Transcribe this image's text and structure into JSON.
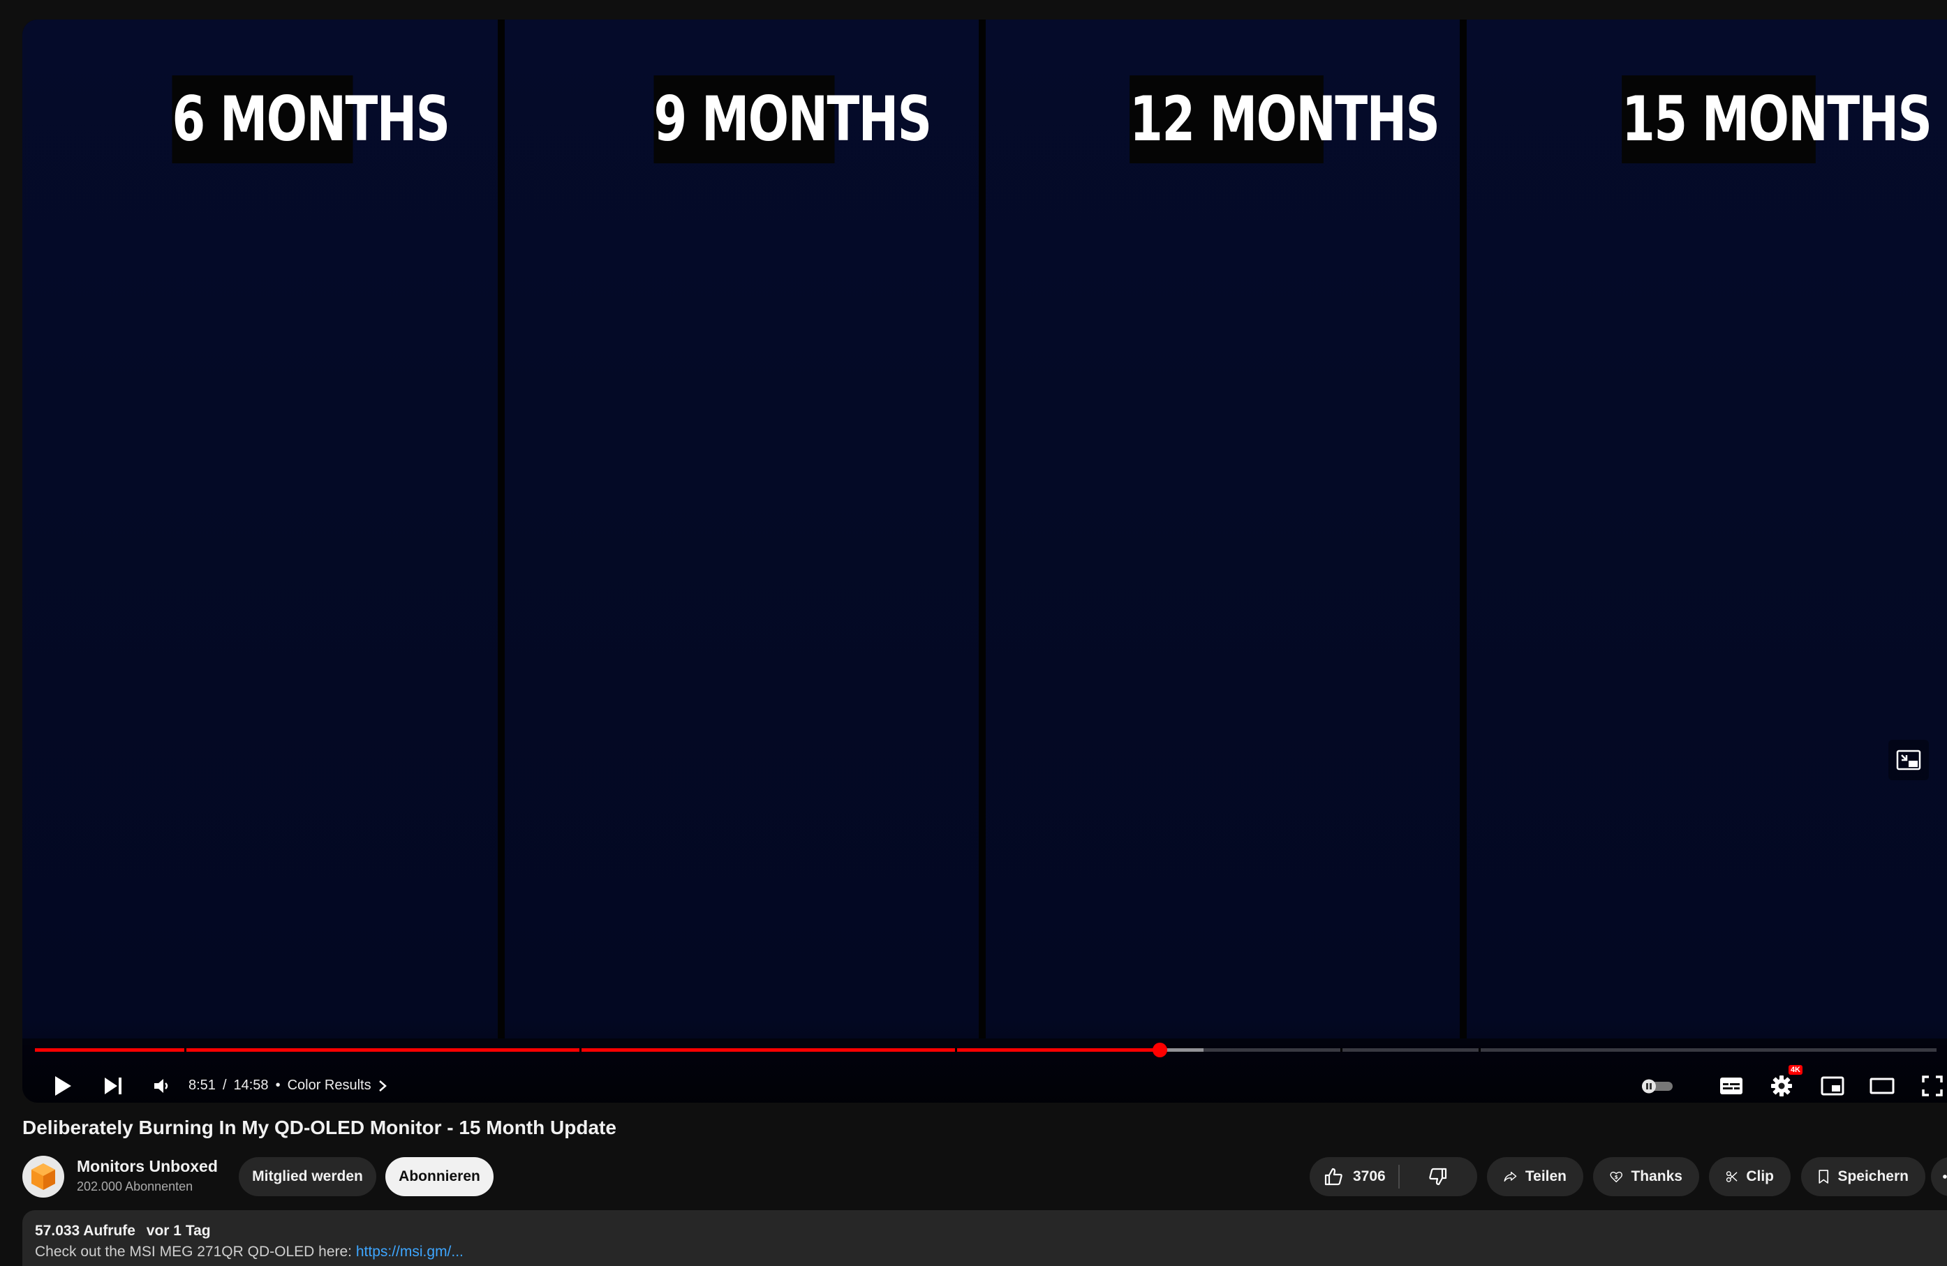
{
  "video": {
    "panels": [
      {
        "label": "6 MONTHS"
      },
      {
        "label": "9 MONTHS"
      },
      {
        "label": "12 MONTHS"
      },
      {
        "label": "15 MONTHS"
      }
    ]
  },
  "player": {
    "time_current": "8:51",
    "time_separator": "/",
    "time_total": "14:58",
    "chapter_separator": "•",
    "chapter_title": "Color Results",
    "progress_played_fraction": 0.5915,
    "progress_buffered_fraction": 0.6146,
    "quality_badge": "4K",
    "icons": {
      "play": "play-icon",
      "next": "next-icon",
      "volume": "volume-icon",
      "autoplay": "autoplay-toggle-icon",
      "subtitles": "subtitles-icon",
      "settings": "gear-icon",
      "miniplayer": "miniplayer-icon",
      "theater": "theater-mode-icon",
      "fullscreen": "fullscreen-icon"
    },
    "accent_color": "#ff0000"
  },
  "title": "Deliberately Burning In My QD-OLED Monitor - 15 Month Update",
  "channel": {
    "name": "Monitors Unboxed",
    "subscribers": "202.000 Abonnenten",
    "join_label": "Mitglied werden",
    "subscribe_label": "Abonnieren"
  },
  "actions": {
    "like_count": "3706",
    "share_label": "Teilen",
    "thanks_label": "Thanks",
    "clip_label": "Clip",
    "save_label": "Speichern"
  },
  "description": {
    "views": "57.033 Aufrufe",
    "age": "vor 1 Tag",
    "line2_prefix": "Check out the MSI MEG 271QR QD-OLED here:",
    "line2_link": "https://msi.gm/..."
  }
}
